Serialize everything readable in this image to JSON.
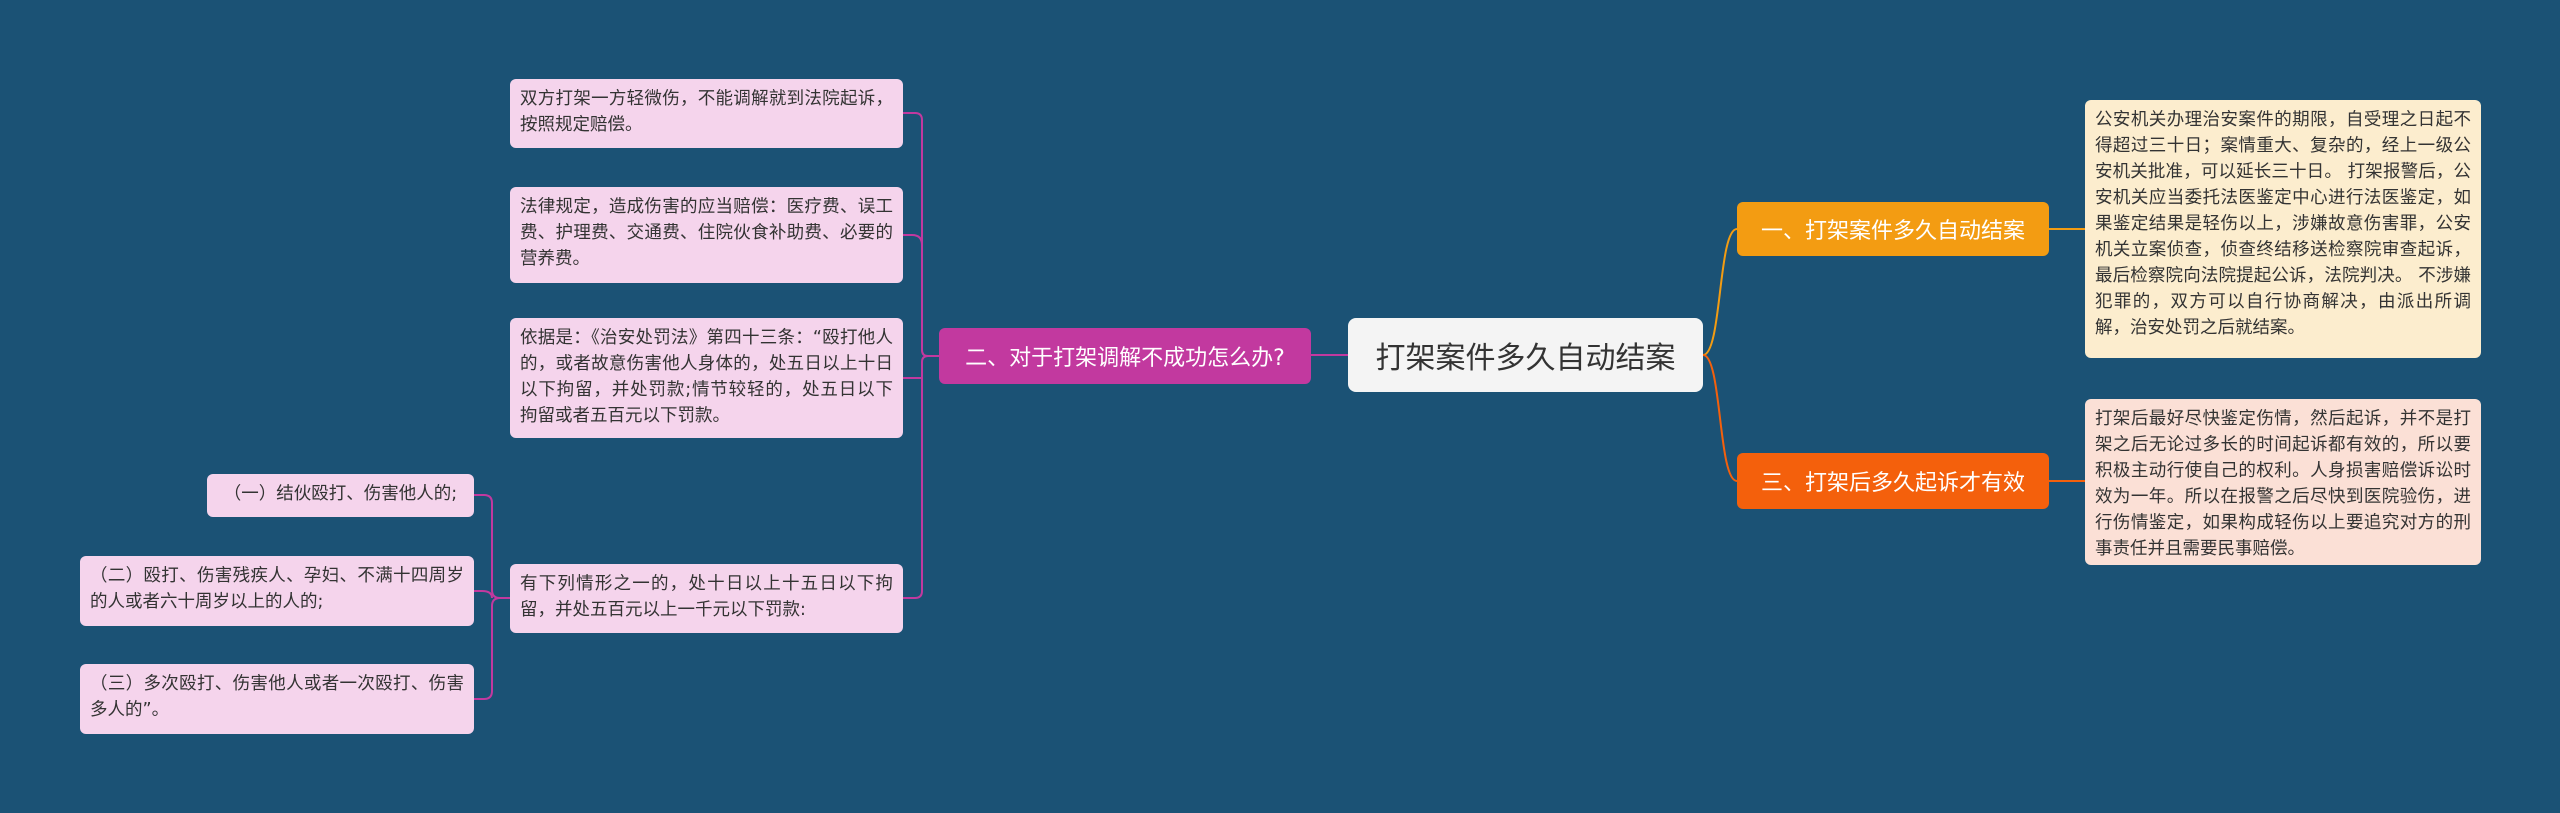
{
  "root": {
    "title": "打架案件多久自动结案"
  },
  "branches": {
    "b1": {
      "label": "一、打架案件多久自动结案"
    },
    "b2": {
      "label": "三、打架后多久起诉才有效"
    },
    "b3": {
      "label": "二、对于打架调解不成功怎么办?"
    }
  },
  "leaves": {
    "l1": "公安机关办理治安案件的期限，自受理之日起不得超过三十日；案情重大、复杂的，经上一级公安机关批准，可以延长三十日。 打架报警后，公安机关应当委托法医鉴定中心进行法医鉴定，如果鉴定结果是轻伤以上，涉嫌故意伤害罪，公安机关立案侦查，侦查终结移送检察院审查起诉，最后检察院向法院提起公诉，法院判决。 不涉嫌犯罪的，双方可以自行协商解决，由派出所调解，治安处罚之后就结案。",
    "l2": "打架后最好尽快鉴定伤情，然后起诉，并不是打架之后无论过多长的时间起诉都有效的，所以要积极主动行使自己的权利。人身损害赔偿诉讼时效为一年。所以在报警之后尽快到医院验伤，进行伤情鉴定，如果构成轻伤以上要追究对方的刑事责任并且需要民事赔偿。",
    "p1": "双方打架一方轻微伤，不能调解就到法院起诉，按照规定赔偿。",
    "p2": "法律规定，造成伤害的应当赔偿：医疗费、误工费、护理费、交通费、住院伙食补助费、必要的营养费。",
    "p3": "依据是：《治安处罚法》第四十三条：“殴打他人的，或者故意伤害他人身体的，处五日以上十日以下拘留，并处罚款;情节较轻的，处五日以下拘留或者五百元以下罚款。",
    "p4": "有下列情形之一的，处十日以上十五日以下拘留，并处五百元以上一千元以下罚款:",
    "s1": "（一）结伙殴打、伤害他人的;",
    "s2": "（二）殴打、伤害残疾人、孕妇、不满十四周岁的人或者六十周岁以上的人的;",
    "s3": "（三）多次殴打、伤害他人或者一次殴打、伤害多人的”。"
  },
  "colors": {
    "background": "#1b5275",
    "root": "#f4f4f4",
    "branch_orange": "#f39c12",
    "branch_red": "#f4600c",
    "branch_pink": "#c2399f",
    "leaf_orange": "#fcedce",
    "leaf_red": "#fbe0d6",
    "leaf_pink": "#f5d4ec"
  }
}
